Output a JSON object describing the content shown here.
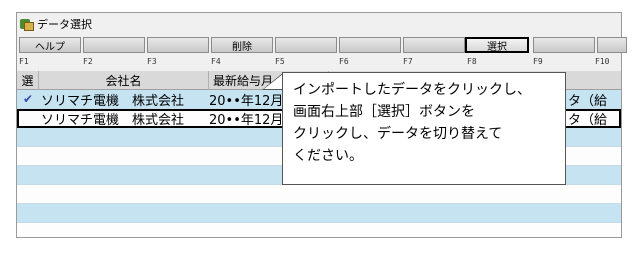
{
  "window": {
    "title": "データ選択"
  },
  "toolbar": {
    "help_label": "ヘルプ",
    "delete_label": "削除",
    "select_label": "選択",
    "fkey_labels": [
      "F1",
      "F2",
      "F3",
      "F4",
      "F5",
      "F6",
      "F7",
      "F8",
      "F9",
      "F10"
    ]
  },
  "table": {
    "col_select": "選",
    "col_company": "会社名",
    "col_latest": "最新給与月",
    "rows": [
      {
        "check": "✔",
        "company": "ソリマチ電機　株式会社",
        "latest": "20••年12月",
        "tail": "タ（給"
      },
      {
        "check": "",
        "company": "ソリマチ電機　株式会社",
        "latest": "20••年12月",
        "tail": "タ（給"
      }
    ]
  },
  "callout": {
    "line1": "インポートしたデータをクリックし、",
    "line2": "画面右上部［選択］ボタンを",
    "line3": "クリックし、データを切り替えて",
    "line4": "ください。"
  }
}
